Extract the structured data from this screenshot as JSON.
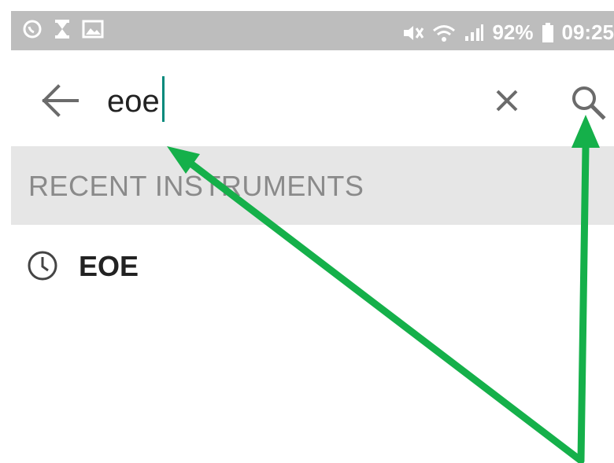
{
  "status_bar": {
    "left_icons": [
      "whatsapp-icon",
      "hourglass-icon",
      "image-icon"
    ],
    "mute_icon": "mute-icon",
    "wifi_icon": "wifi-icon",
    "signal_icon": "signal-icon",
    "battery_icon": "battery-icon",
    "battery": "92%",
    "time": "09:25"
  },
  "search": {
    "value": "eoe",
    "back_icon": "back-arrow-icon",
    "clear_icon": "close-icon",
    "search_icon": "search-icon",
    "accent_color": "#00897b"
  },
  "section": {
    "title": "RECENT INSTRUMENTS"
  },
  "recent_items": [
    {
      "label": "EOE",
      "icon": "clock-icon"
    }
  ],
  "annotation": {
    "arrow_color": "#15b04a"
  }
}
